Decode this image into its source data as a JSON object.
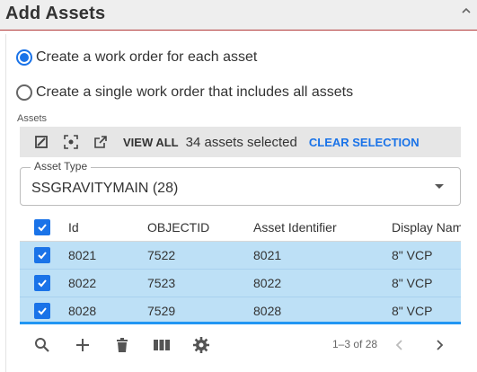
{
  "header": {
    "title": "Add Assets"
  },
  "options": [
    {
      "label": "Create a work order for each asset",
      "selected": true
    },
    {
      "label": "Create a single work order that includes all assets",
      "selected": false
    }
  ],
  "assets_label": "Assets",
  "toolbar": {
    "view_all": "VIEW ALL",
    "selected_text": "34 assets selected",
    "clear_selection": "CLEAR SELECTION"
  },
  "asset_type": {
    "legend": "Asset Type",
    "value": "SSGRAVITYMAIN (28)"
  },
  "table": {
    "columns": [
      "Id",
      "OBJECTID",
      "Asset Identifier",
      "Display Nam"
    ],
    "rows": [
      [
        "8021",
        "7522",
        "8021",
        "8\" VCP"
      ],
      [
        "8022",
        "7523",
        "8022",
        "8\" VCP"
      ],
      [
        "8028",
        "7529",
        "8028",
        "8\" VCP"
      ]
    ]
  },
  "pagination": {
    "text": "1–3 of 28"
  },
  "colors": {
    "accent": "#1a73e8",
    "selected_row": "#bde0f6",
    "header_rule": "#b23b3b"
  }
}
